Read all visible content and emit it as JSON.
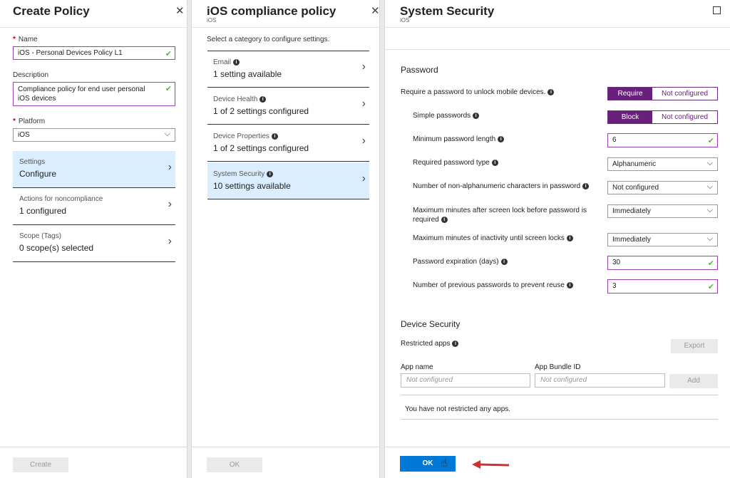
{
  "create_policy": {
    "title": "Create Policy",
    "name_label": "Name",
    "name_value": "iOS - Personal Devices Policy L1",
    "description_label": "Description",
    "description_value_line1": "Compliance policy for end user personal",
    "description_value_line2": "iOS devices",
    "platform_label": "Platform",
    "platform_value": "iOS",
    "items": [
      {
        "title": "Settings",
        "value": "Configure"
      },
      {
        "title": "Actions for noncompliance",
        "value": "1 configured"
      },
      {
        "title": "Scope (Tags)",
        "value": "0 scope(s) selected"
      }
    ],
    "create_button": "Create"
  },
  "compliance": {
    "title": "iOS compliance policy",
    "subtitle": "iOS",
    "instruction": "Select a category to configure settings.",
    "categories": [
      {
        "title": "Email",
        "value": "1 setting available"
      },
      {
        "title": "Device Health",
        "value": "1 of 2 settings configured"
      },
      {
        "title": "Device Properties",
        "value": "1 of 2 settings configured"
      },
      {
        "title": "System Security",
        "value": "10 settings available"
      }
    ],
    "ok_button": "OK"
  },
  "system_security": {
    "title": "System Security",
    "subtitle": "iOS",
    "password_heading": "Password",
    "rows": {
      "require_password": {
        "label": "Require a password to unlock mobile devices.",
        "on": "Require",
        "off": "Not configured"
      },
      "simple_passwords": {
        "label": "Simple passwords",
        "on": "Block",
        "off": "Not configured"
      },
      "min_length": {
        "label": "Minimum password length",
        "value": "6"
      },
      "password_type": {
        "label": "Required password type",
        "value": "Alphanumeric"
      },
      "non_alnum": {
        "label": "Number of non-alphanumeric characters in password",
        "value": "Not configured"
      },
      "screen_lock_line1": "Maximum minutes after screen lock before password is",
      "screen_lock_line2": "required",
      "screen_lock_value": "Immediately",
      "inactivity": {
        "label": "Maximum minutes of inactivity until screen locks",
        "value": "Immediately"
      },
      "expiration": {
        "label": "Password expiration (days)",
        "value": "30"
      },
      "prev_passwords": {
        "label": "Number of previous passwords to prevent reuse",
        "value": "3"
      }
    },
    "device_heading": "Device Security",
    "restricted_apps_label": "Restricted apps",
    "export_button": "Export",
    "app_name_label": "App name",
    "bundle_label": "App Bundle ID",
    "app_name_placeholder": "Not configured",
    "bundle_placeholder": "Not configured",
    "add_button": "Add",
    "empty_message": "You have not restricted any apps.",
    "ok_button": "OK"
  },
  "colors": {
    "accent": "#0078d7",
    "toggle": "#68217a",
    "selected_bg": "#dbeeff"
  }
}
